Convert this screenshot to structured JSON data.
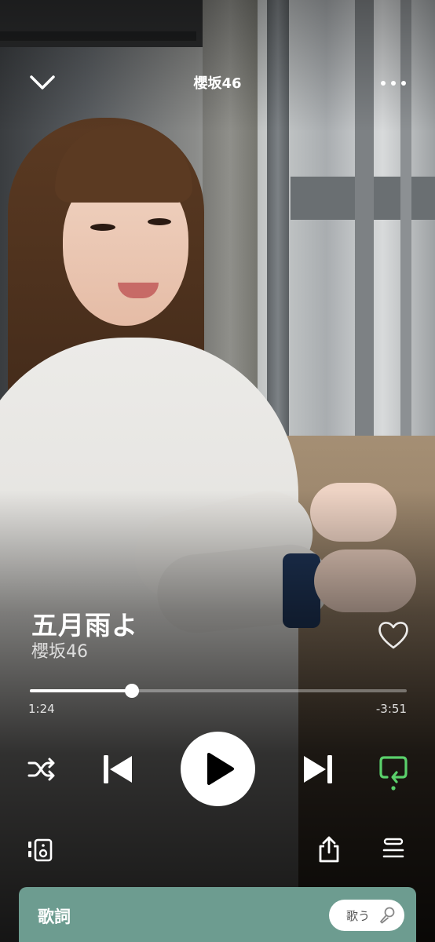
{
  "header": {
    "title": "櫻坂46"
  },
  "track": {
    "title": "五月雨よ",
    "artist": "櫻坂46"
  },
  "playback": {
    "elapsed": "1:24",
    "remaining": "-3:51",
    "progress_fraction": 0.27
  },
  "controls": {
    "repeat_color": "#5ad06b"
  },
  "lyrics": {
    "label": "歌詞",
    "sing_label": "歌う"
  },
  "icons": [
    "chevron-down-icon",
    "more-icon",
    "heart-icon",
    "shuffle-icon",
    "previous-icon",
    "play-icon",
    "next-icon",
    "repeat-icon",
    "device-icon",
    "share-icon",
    "queue-icon",
    "microphone-icon"
  ]
}
